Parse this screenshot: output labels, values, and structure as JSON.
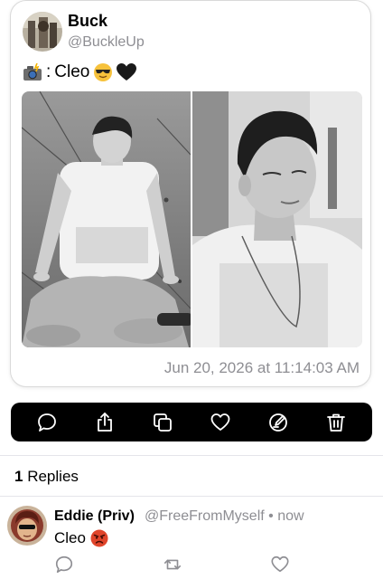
{
  "post": {
    "author_name": "Buck",
    "author_handle": "@BuckleUp",
    "text_prefix": ":",
    "text_main": "Cleo",
    "timestamp": "Jun 20, 2026 at 11:14:03 AM"
  },
  "action_bar": {
    "icons": [
      "comment-icon",
      "share-icon",
      "copy-icon",
      "heart-icon",
      "edit-icon",
      "trash-icon"
    ]
  },
  "replies": {
    "count": "1",
    "label": "Replies"
  },
  "reply": {
    "name": "Eddie (Priv)",
    "handle": "@FreeFromMyself",
    "separator": "•",
    "time": "now",
    "text": "Cleo",
    "actions": [
      "reply-icon",
      "retweet-icon",
      "like-icon"
    ]
  },
  "colors": {
    "secondary_text": "#8e8e93",
    "bar_background": "#000000",
    "angry_emoji": "#e0452b"
  }
}
